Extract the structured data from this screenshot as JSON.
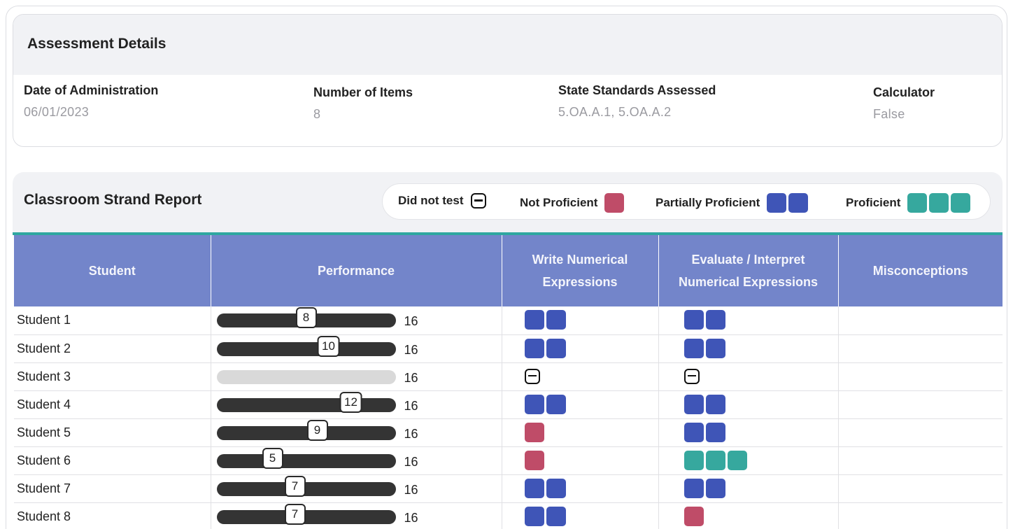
{
  "details": {
    "title": "Assessment Details",
    "fields": [
      {
        "label": "Date of Administration",
        "value": "06/01/2023"
      },
      {
        "label": "Number of Items",
        "value": "8"
      },
      {
        "label": "State Standards Assessed",
        "value": "5.OA.A.1, 5.OA.A.2"
      },
      {
        "label": "Calculator",
        "value": "False"
      }
    ]
  },
  "report": {
    "title": "Classroom Strand Report",
    "legend": {
      "did_not_test": "Did not test",
      "not_proficient": "Not Proficient",
      "partially_proficient": "Partially Proficient",
      "proficient": "Proficient"
    },
    "columns": [
      "Student",
      "Performance",
      "Write Numerical Expressions",
      "Evaluate / Interpret Numerical Expressions",
      "Misconceptions"
    ],
    "max_score": 16,
    "rows": [
      {
        "student": "Student 1",
        "score": 8,
        "max": "16",
        "write": "partial",
        "evaluate": "partial",
        "misconceptions": ""
      },
      {
        "student": "Student 2",
        "score": 10,
        "max": "16",
        "write": "partial",
        "evaluate": "partial",
        "misconceptions": ""
      },
      {
        "student": "Student 3",
        "score": null,
        "max": "16",
        "write": "dnt",
        "evaluate": "dnt",
        "misconceptions": ""
      },
      {
        "student": "Student 4",
        "score": 12,
        "max": "16",
        "write": "partial",
        "evaluate": "partial",
        "misconceptions": ""
      },
      {
        "student": "Student 5",
        "score": 9,
        "max": "16",
        "write": "not",
        "evaluate": "partial",
        "misconceptions": ""
      },
      {
        "student": "Student 6",
        "score": 5,
        "max": "16",
        "write": "not",
        "evaluate": "proficient",
        "misconceptions": ""
      },
      {
        "student": "Student 7",
        "score": 7,
        "max": "16",
        "write": "partial",
        "evaluate": "partial",
        "misconceptions": ""
      },
      {
        "student": "Student 8",
        "score": 7,
        "max": "16",
        "write": "partial",
        "evaluate": "not",
        "misconceptions": ""
      }
    ]
  },
  "colors": {
    "header": "#7385ca",
    "partially_proficient": "#3f55b7",
    "proficient": "#36a89e",
    "not_proficient": "#bf4c68",
    "accent_rule": "#2fa7a0"
  }
}
